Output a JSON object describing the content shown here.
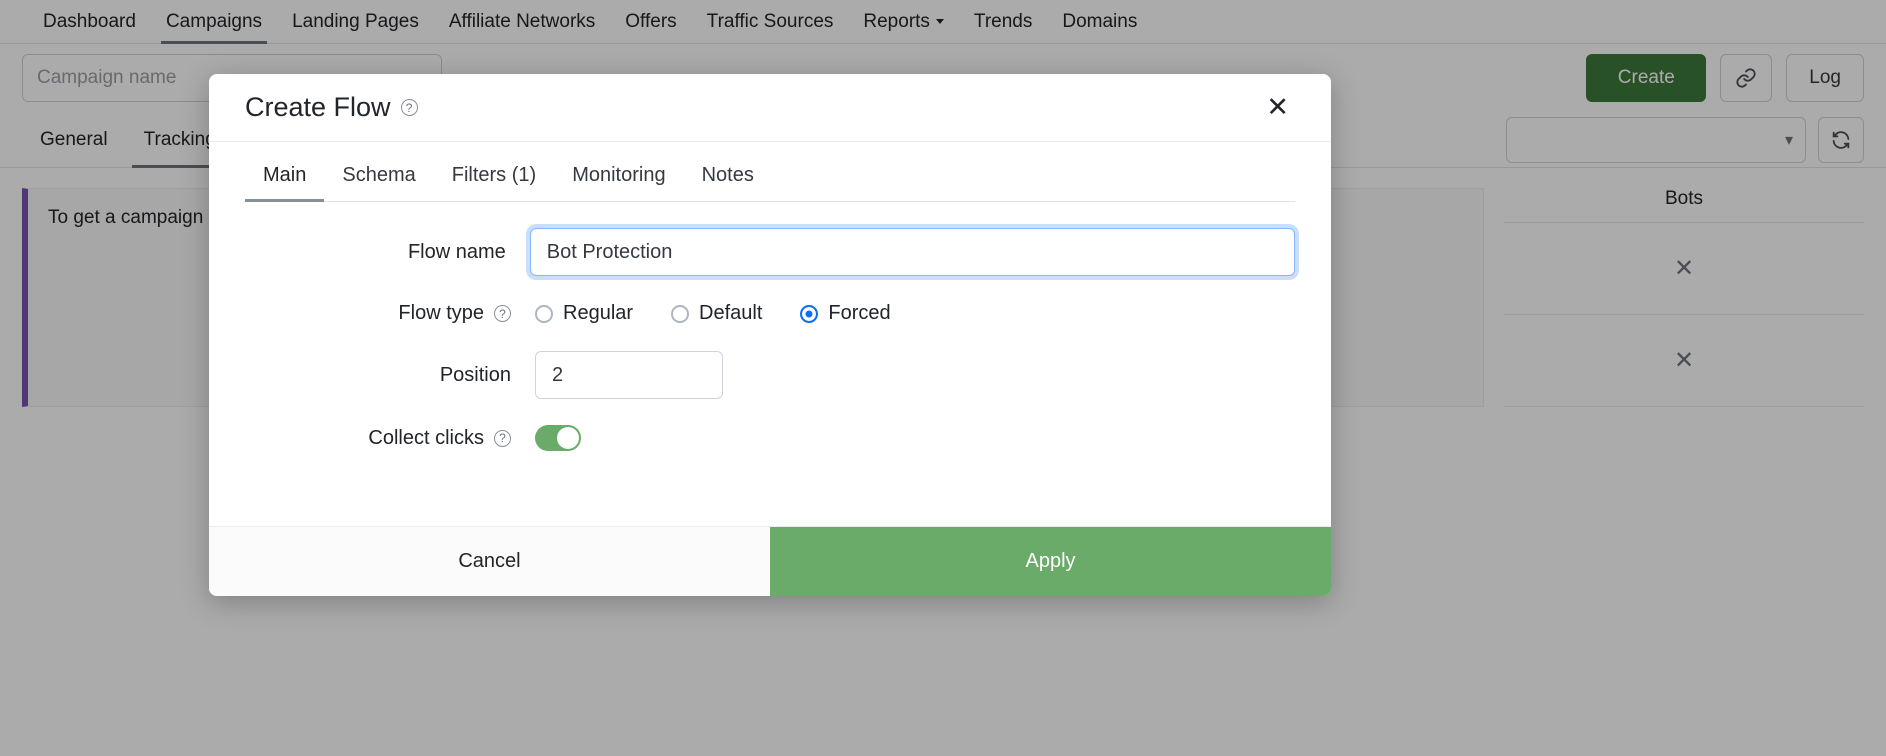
{
  "navbar": {
    "items": [
      {
        "label": "Dashboard",
        "active": false,
        "caret": false
      },
      {
        "label": "Campaigns",
        "active": true,
        "caret": false
      },
      {
        "label": "Landing Pages",
        "active": false,
        "caret": false
      },
      {
        "label": "Affiliate Networks",
        "active": false,
        "caret": false
      },
      {
        "label": "Offers",
        "active": false,
        "caret": false
      },
      {
        "label": "Traffic Sources",
        "active": false,
        "caret": false
      },
      {
        "label": "Reports",
        "active": false,
        "caret": true
      },
      {
        "label": "Trends",
        "active": false,
        "caret": false
      },
      {
        "label": "Domains",
        "active": false,
        "caret": false
      }
    ]
  },
  "toolbar": {
    "campaign_search_placeholder": "Campaign name",
    "campaign_search_value": "",
    "create_label": "Create",
    "link_icon": "link-icon",
    "log_label": "Log"
  },
  "subtabs": {
    "items": [
      {
        "label": "General",
        "active": false
      },
      {
        "label": "Tracking",
        "active": true
      }
    ],
    "select_value": "",
    "refresh_icon": "refresh-icon"
  },
  "content": {
    "alert_text": "To get a campaign",
    "bots_title": "Bots",
    "row_close_icon": "close-icon"
  },
  "modal": {
    "title": "Create Flow",
    "title_help_icon": "help-circle-icon",
    "close_icon": "close-icon",
    "tabs": [
      {
        "label": "Main",
        "active": true
      },
      {
        "label": "Schema",
        "active": false
      },
      {
        "label": "Filters (1)",
        "active": false
      },
      {
        "label": "Monitoring",
        "active": false
      },
      {
        "label": "Notes",
        "active": false
      }
    ],
    "flow_name": {
      "label": "Flow name",
      "value": "Bot Protection",
      "placeholder": "Flow name"
    },
    "flow_type": {
      "label": "Flow type",
      "help_icon": "help-circle-icon",
      "options": [
        {
          "label": "Regular",
          "selected": false
        },
        {
          "label": "Default",
          "selected": false
        },
        {
          "label": "Forced",
          "selected": true
        }
      ]
    },
    "position": {
      "label": "Position",
      "value": "2",
      "placeholder": "Position"
    },
    "collect_clicks": {
      "label": "Collect clicks",
      "help_icon": "help-circle-icon",
      "enabled": true
    },
    "footer": {
      "cancel_label": "Cancel",
      "apply_label": "Apply"
    }
  },
  "colors": {
    "accent_green": "#6aab6a",
    "create_green": "#3d7a3d",
    "radio_blue": "#0d6efd",
    "alert_purple": "#7952b3"
  }
}
